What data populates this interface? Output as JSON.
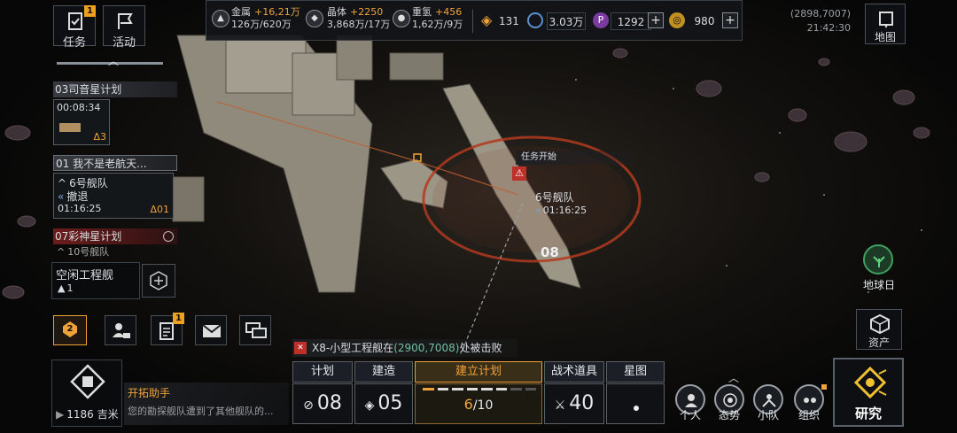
{
  "top_left": {
    "tasks": {
      "label": "任务",
      "badge": "1"
    },
    "activity": {
      "label": "活动"
    }
  },
  "resources": {
    "metal": {
      "label": "金属",
      "delta": "+16,21万",
      "amount": "126万/620万"
    },
    "crystal": {
      "label": "晶体",
      "delta": "+2250",
      "amount": "3,868万/17万"
    },
    "deuterium": {
      "label": "重氢",
      "delta": "+456",
      "amount": "1,62万/9万"
    },
    "r1": "131",
    "r2": "3.03万",
    "r3": "1292",
    "r4": "980",
    "plus": "+"
  },
  "top_right": {
    "coords": "(2898,7007)",
    "time": "21:42:30",
    "map_label": "地图"
  },
  "quests": [
    {
      "title": "03司音星计划",
      "timer": "00:08:34",
      "count": "Δ3"
    },
    {
      "title": "01 我不是老航天...",
      "fleet": "6号舰队",
      "status": "撤退",
      "timer": "01:16:25",
      "count": "Δ01"
    },
    {
      "title": "07彩神星计划",
      "fleet": "10号舰队"
    }
  ],
  "idle_ships": {
    "label": "空闲工程舰",
    "value": "1"
  },
  "map_markers": {
    "task_start": "任务开始",
    "fleet": "6号舰队",
    "fleet_timer": "01:16:25",
    "sector": "08"
  },
  "rank_badge": "2",
  "notif_badge": "1",
  "alert": {
    "prefix": "X8-小型工程舰在",
    "coords": "(2900,7008)",
    "suffix": "处被击败"
  },
  "bottom_left": {
    "distance": "1186 吉米",
    "helper_title": "开拓助手",
    "helper_text": "您的勘探舰队遭到了其他舰队的..."
  },
  "bottom_tabs": {
    "plan": {
      "label": "计划",
      "value": "08"
    },
    "build": {
      "label": "建造",
      "value": "05"
    },
    "establish": {
      "label": "建立计划",
      "progress": "6",
      "total": "/10"
    },
    "tactics": {
      "label": "战术道具",
      "value": "40"
    },
    "starmap": {
      "label": "星图"
    }
  },
  "right_buttons": {
    "earth": "地球日",
    "assets": "资产",
    "research": "研究",
    "personal": "个人",
    "situation": "态势",
    "squad": "小队",
    "org": "组织"
  },
  "colors": {
    "accent": "#f0a23a",
    "alert_red": "#c0302a",
    "ring": "#b23a1e"
  }
}
